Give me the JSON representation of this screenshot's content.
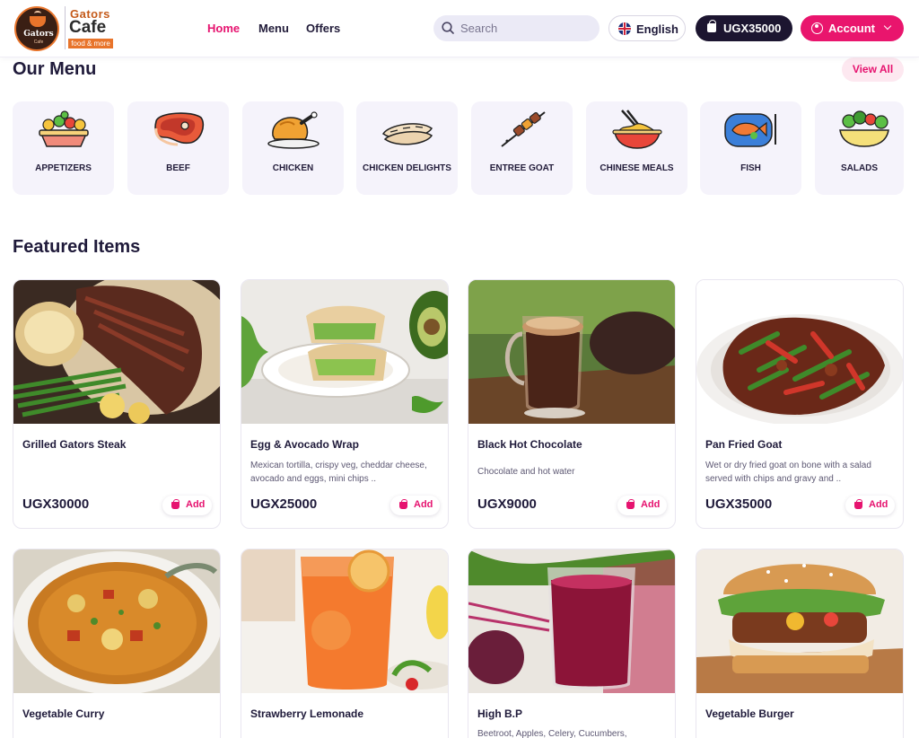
{
  "brand": {
    "badge_text": "Gators",
    "badge_sub": "Cafe",
    "name_top": "Gators",
    "name_main": "Cafe",
    "tagline": "food & more"
  },
  "nav": [
    {
      "label": "Home",
      "active": true
    },
    {
      "label": "Menu",
      "active": false
    },
    {
      "label": "Offers",
      "active": false
    }
  ],
  "search": {
    "placeholder": "Search",
    "value": "",
    "icon": "search-icon"
  },
  "language": {
    "label": "English",
    "icon": "uk-flag-icon"
  },
  "cart": {
    "label": "UGX35000",
    "icon": "shopping-bag-icon"
  },
  "account": {
    "label": "Account",
    "icon": "user-circle-icon"
  },
  "colors": {
    "accent": "#e6136f",
    "dark": "#1c1530",
    "card_bg": "#f5f3fb"
  },
  "menu_section": {
    "title": "Our Menu",
    "view_all": "View All",
    "categories": [
      {
        "label": "APPETIZERS",
        "icon": "appetizers-bowl-icon"
      },
      {
        "label": "BEEF",
        "icon": "steak-icon"
      },
      {
        "label": "CHICKEN",
        "icon": "roast-chicken-icon"
      },
      {
        "label": "CHICKEN DELIGHTS",
        "icon": "chicken-wraps-icon"
      },
      {
        "label": "ENTREE GOAT",
        "icon": "skewer-icon"
      },
      {
        "label": "CHINESE MEALS",
        "icon": "noodle-bowl-icon"
      },
      {
        "label": "FISH",
        "icon": "fish-plate-icon"
      },
      {
        "label": "SALADS",
        "icon": "salad-bowl-icon"
      }
    ]
  },
  "featured": {
    "title": "Featured Items",
    "add_label": "Add",
    "items": [
      {
        "name": "Grilled Gators Steak",
        "desc": "",
        "price": "UGX30000"
      },
      {
        "name": "Egg & Avocado Wrap",
        "desc": "Mexican tortilla, crispy veg, cheddar cheese, avocado and eggs, mini chips ..",
        "price": "UGX25000"
      },
      {
        "name": "Black Hot Chocolate",
        "desc": "Chocolate and hot water",
        "price": "UGX9000"
      },
      {
        "name": "Pan Fried Goat",
        "desc": "Wet or dry fried goat on bone with a salad served with chips and gravy and ..",
        "price": "UGX35000"
      },
      {
        "name": "Vegetable Curry",
        "desc": "",
        "price": ""
      },
      {
        "name": "Strawberry Lemonade",
        "desc": "",
        "price": ""
      },
      {
        "name": "High B.P",
        "desc": "Beetroot, Apples, Celery, Cucumbers,",
        "price": ""
      },
      {
        "name": "Vegetable Burger",
        "desc": "",
        "price": ""
      }
    ]
  }
}
